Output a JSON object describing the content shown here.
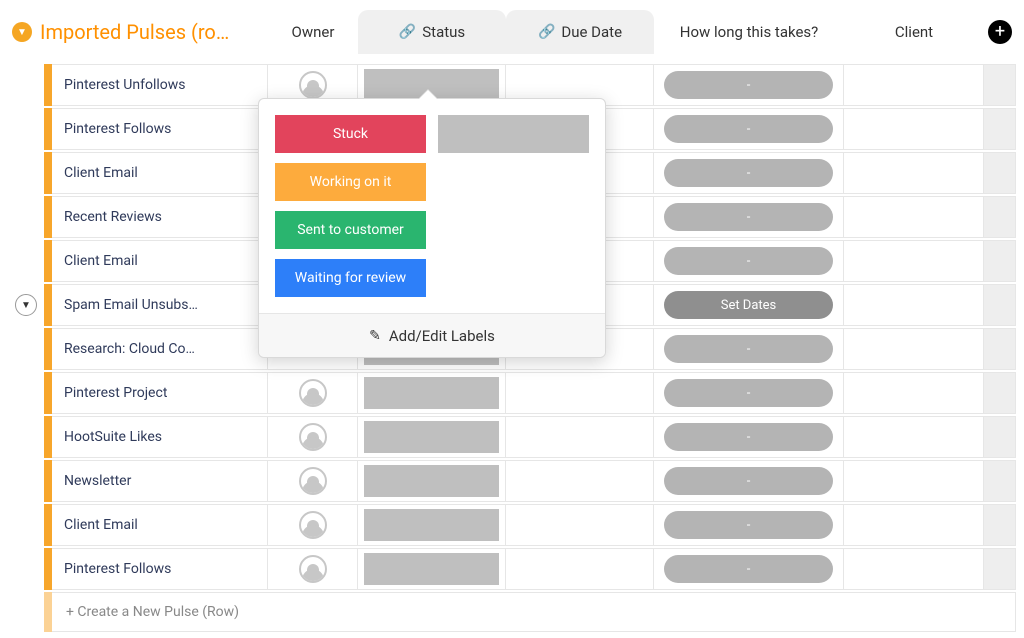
{
  "group": {
    "title": "Imported Pulses (ro…",
    "accent_color": "#f7a62b"
  },
  "columns": {
    "owner": "Owner",
    "status": "Status",
    "due": "Due Date",
    "howlong": "How long this takes?",
    "client": "Client"
  },
  "rows": [
    {
      "name": "Pinterest Unfollows",
      "owner": true,
      "howlong": "-",
      "expanded": false
    },
    {
      "name": "Pinterest Follows",
      "owner": false,
      "howlong": "-",
      "expanded": false
    },
    {
      "name": "Client Email",
      "owner": false,
      "howlong": "-",
      "expanded": false
    },
    {
      "name": "Recent Reviews",
      "owner": false,
      "howlong": "-",
      "expanded": false
    },
    {
      "name": "Client Email",
      "owner": false,
      "howlong": "-",
      "expanded": false
    },
    {
      "name": "Spam Email Unsubs…",
      "owner": false,
      "howlong": "Set Dates",
      "howlong_dark": true,
      "expanded": true
    },
    {
      "name": "Research: Cloud Co…",
      "owner": false,
      "howlong": "-",
      "expanded": false
    },
    {
      "name": "Pinterest Project",
      "owner": true,
      "howlong": "-",
      "expanded": false
    },
    {
      "name": "HootSuite Likes",
      "owner": true,
      "howlong": "-",
      "expanded": false
    },
    {
      "name": "Newsletter",
      "owner": true,
      "howlong": "-",
      "expanded": false
    },
    {
      "name": "Client Email",
      "owner": true,
      "howlong": "-",
      "expanded": false
    },
    {
      "name": "Pinterest Follows",
      "owner": true,
      "howlong": "-",
      "expanded": false
    }
  ],
  "new_row_placeholder": "+ Create a New Pulse (Row)",
  "status_labels": {
    "stuck": "Stuck",
    "working": "Working on it",
    "sent": "Sent to customer",
    "waiting": "Waiting for review",
    "edit": "Add/Edit Labels"
  }
}
